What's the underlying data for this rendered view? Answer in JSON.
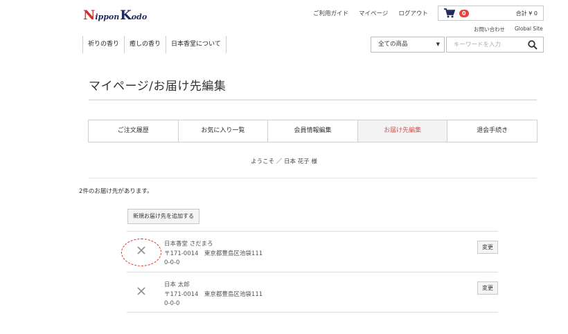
{
  "logo": {
    "cap1": "N",
    "rest1": "ippon",
    "cap2": "K",
    "rest2": "odo"
  },
  "header": {
    "links": [
      "ご利用ガイド",
      "マイページ",
      "ログアウト"
    ],
    "cart": {
      "count": "0",
      "total": "合計 ¥ 0"
    },
    "sub_links": [
      "お問い合わせ",
      "Global Site"
    ]
  },
  "nav": {
    "items": [
      "祈りの香り",
      "癒しの香り",
      "日本香堂について"
    ]
  },
  "search": {
    "category": "全ての商品",
    "placeholder": "キーワードを入力"
  },
  "page": {
    "title": "マイページ/お届け先編集"
  },
  "tabs": [
    {
      "label": "ご注文履歴"
    },
    {
      "label": "お気に入り一覧"
    },
    {
      "label": "会員情報編集"
    },
    {
      "label": "お届け先編集",
      "active": true
    },
    {
      "label": "退会手続き"
    }
  ],
  "welcome": "ようこそ ／ 日本 花子 様",
  "address_count_text": "2件のお届け先があります。",
  "add_button": "新規お届け先を追加する",
  "addresses": [
    {
      "name": "日本香堂 さだまろ",
      "postal_address": "〒171-0014　東京都豊島区池袋111",
      "line3": "0-0-0",
      "change_label": "変更"
    },
    {
      "name": "日本 太郎",
      "postal_address": "〒171-0014　東京都豊島区池袋111",
      "line3": "0-0-0",
      "change_label": "変更"
    }
  ],
  "colors": {
    "accent": "#d9534f",
    "badge": "#e0463a",
    "logo_red": "#d22c2c",
    "logo_navy": "#1f2a5a"
  }
}
